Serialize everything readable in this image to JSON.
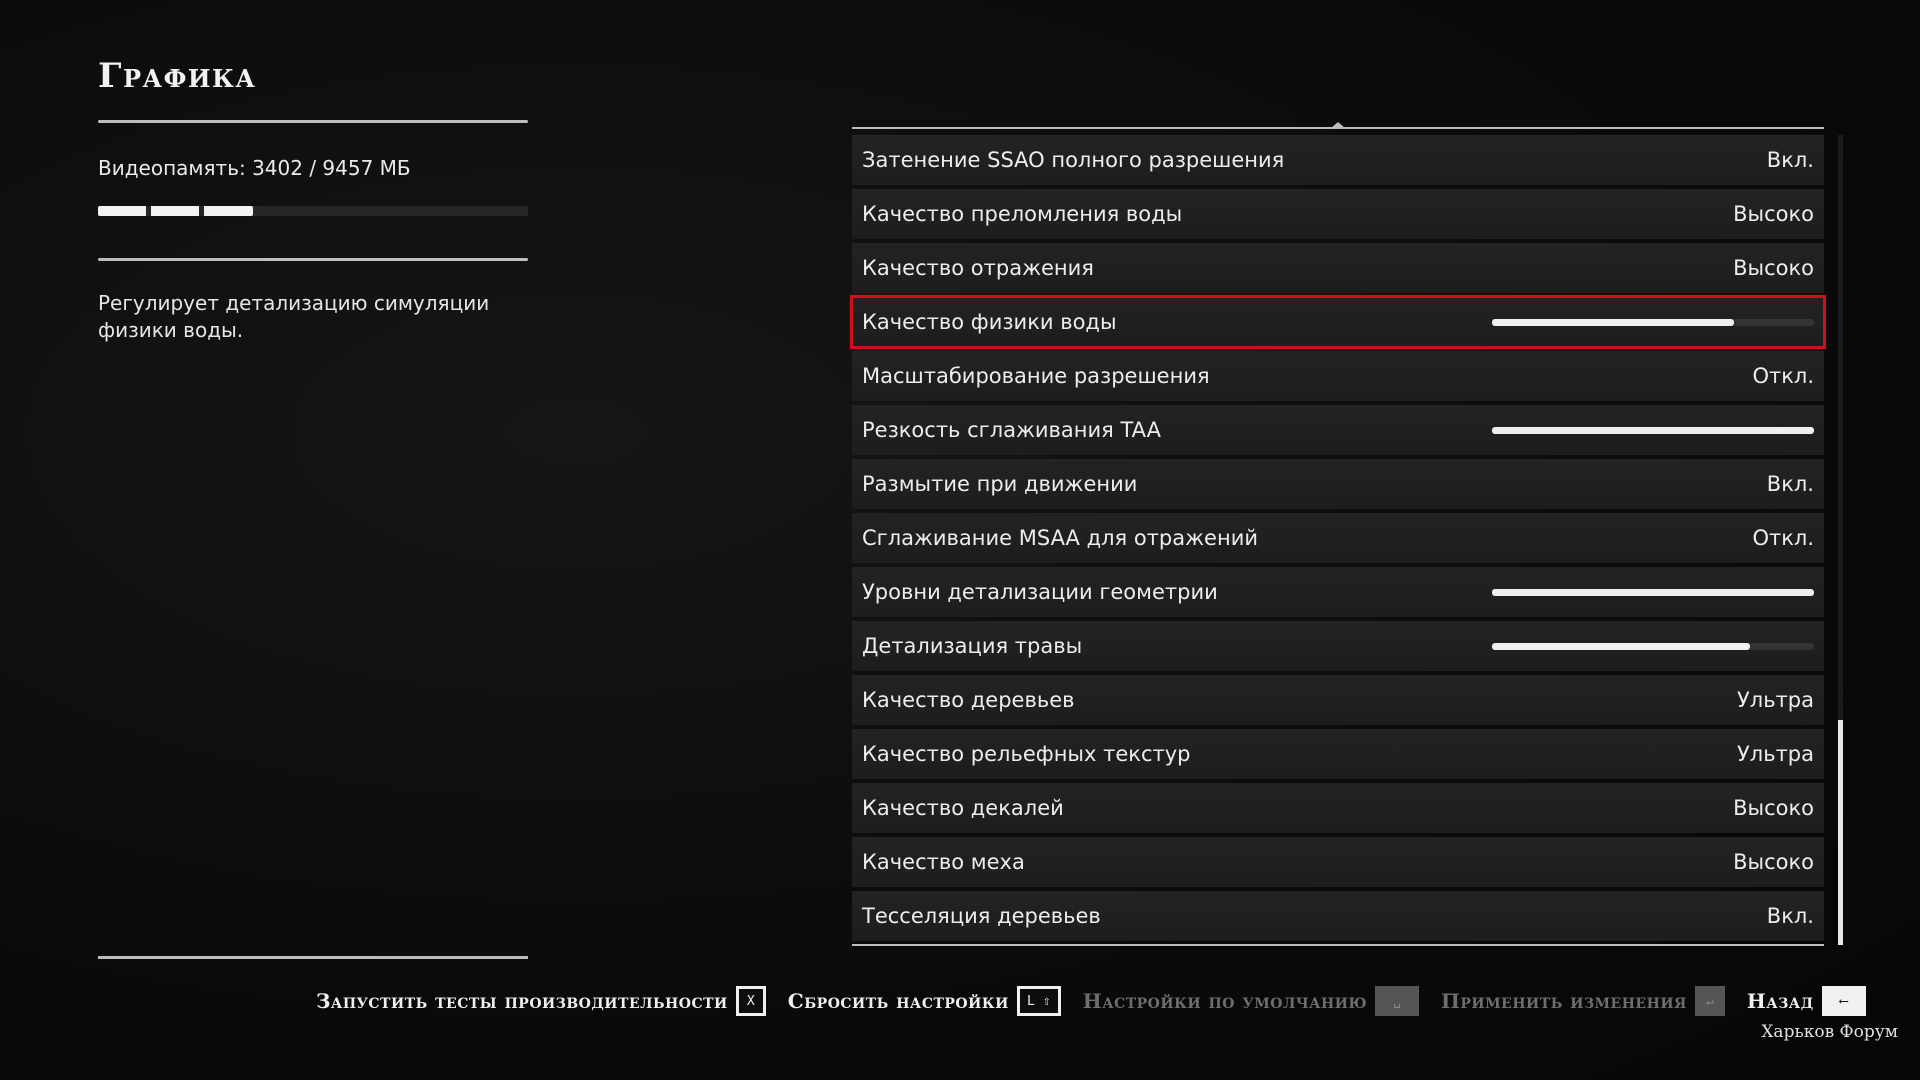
{
  "page": {
    "title": "Графика",
    "vram": {
      "label": "Видеопамять:  3402  /  9457  МБ",
      "used_mb": 3402,
      "total_mb": 9457
    },
    "description": "Регулирует детализацию симуляции физики воды."
  },
  "settings": [
    {
      "label": "Затенение SSAO полного разрешения",
      "value": "Вкл."
    },
    {
      "label": "Качество преломления воды",
      "value": "Высоко"
    },
    {
      "label": "Качество отражения",
      "value": "Высоко"
    },
    {
      "label": "Качество физики воды",
      "slider": 0.75,
      "selected": true
    },
    {
      "label": "Масштабирование разрешения",
      "value": "Откл."
    },
    {
      "label": "Резкость сглаживания TAA",
      "slider": 1.0
    },
    {
      "label": "Размытие при движении",
      "value": "Вкл."
    },
    {
      "label": "Сглаживание MSAA для отражений",
      "value": "Откл."
    },
    {
      "label": "Уровни детализации геометрии",
      "slider": 1.0
    },
    {
      "label": "Детализация травы",
      "slider": 0.8
    },
    {
      "label": "Качество деревьев",
      "value": "Ультра"
    },
    {
      "label": "Качество рельефных текстур",
      "value": "Ультра"
    },
    {
      "label": "Качество декалей",
      "value": "Высоко"
    },
    {
      "label": "Качество меха",
      "value": "Высоко"
    },
    {
      "label": "Тесселяция деревьев",
      "value": "Вкл."
    }
  ],
  "footer": {
    "run_tests": {
      "label": "Запустить тесты производительности",
      "key": "X"
    },
    "reset": {
      "label": "Сбросить настройки",
      "key": "L ⇧"
    },
    "defaults": {
      "label": "Настройки по умолчанию",
      "key": "␣"
    },
    "apply": {
      "label": "Применить изменения",
      "key": "↵"
    },
    "back": {
      "label": "Назад",
      "key": "⟵"
    }
  },
  "watermark": "Харьков Форум",
  "colors": {
    "accent_selected": "#c8131f",
    "text": "#ededed",
    "disabled_text": "#6e6e6e"
  }
}
